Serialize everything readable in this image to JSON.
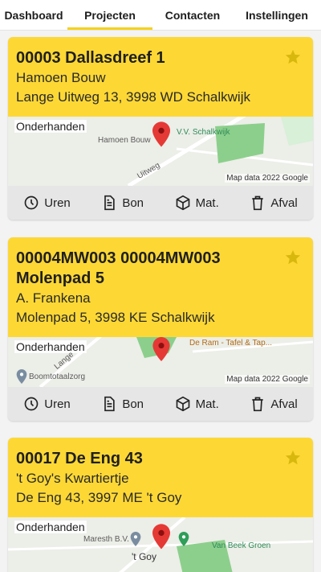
{
  "tabs": [
    {
      "label": "Dashboard",
      "active": false
    },
    {
      "label": "Projecten",
      "active": true
    },
    {
      "label": "Contacten",
      "active": false
    },
    {
      "label": "Instellingen",
      "active": false
    }
  ],
  "projects": [
    {
      "title_lines": [
        "00003 Dallasdreef 1"
      ],
      "client": "Hamoen Bouw",
      "address": "Lange Uitweg 13, 3998 WD Schalkwijk",
      "status": "Onderhanden",
      "map_credit": "Map data 2022 Google",
      "map_labels": {
        "poi_1": "Hamoen Bouw",
        "poi_2": "V.V. Schalkwijk",
        "road": "Uitweg"
      }
    },
    {
      "title_lines": [
        "00004MW003 00004MW003",
        "Molenpad 5"
      ],
      "client": "A. Frankena",
      "address": "Molenpad 5, 3998 KE Schalkwijk",
      "status": "Onderhanden",
      "map_credit": "Map data 2022 Google",
      "map_labels": {
        "poi_1": "Boomtotaalzorg",
        "poi_2": "De Ram - Tafel & Tap...",
        "road": "Lange"
      }
    },
    {
      "title_lines": [
        "00017 De Eng 43"
      ],
      "client": "'t Goy's Kwartiertje",
      "address": "De Eng 43, 3997 ME 't Goy",
      "status": "Onderhanden",
      "map_credit": "",
      "map_labels": {
        "poi_1": "Maresth B.V.",
        "poi_2": "Van Beek Groen",
        "road": "'t Goy"
      }
    }
  ],
  "actions": {
    "uren": "Uren",
    "bon": "Bon",
    "mat": "Mat.",
    "afval": "Afval"
  },
  "colors": {
    "accent": "#fdd835",
    "pin": "#e53935",
    "park": "#8ccf8c"
  },
  "icons": {
    "uren": "clock-icon",
    "bon": "document-icon",
    "mat": "box-icon",
    "afval": "trash-icon",
    "favorite": "star-icon",
    "location": "map-pin-icon"
  }
}
